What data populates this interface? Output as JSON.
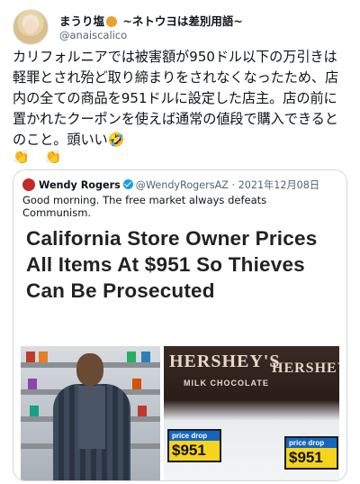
{
  "author": {
    "display_name": "まうり塩🍊 ~ネトウヨは差別用語~",
    "display_name_prefix": "まうり塩",
    "display_name_suffix": " ~ネトウヨは差別用語~",
    "handle": "@anaiscalico"
  },
  "tweet": {
    "text": "カリフォルニアでは被害額が950ドル以下の万引きは軽罪とされ殆ど取り締まりをされなくなったため、店内の全ての商品を951ドルに設定した店主。店の前に置かれたクーポンを使えば通常の値段で購入できるとのこと。頭いい🤣",
    "emojis": "👏 👏"
  },
  "quoted": {
    "name": "Wendy Rogers",
    "handle": "@WendyRogersAZ",
    "date": "2021年12月08日",
    "separator": "·",
    "text": "Good morning. The free market always defeats Communism.",
    "headline": "California Store Owner Prices All Items At $951 So Thieves Can Be Prosecuted",
    "photo": {
      "candy_label_1": "HERSHEY'S",
      "candy_label_2": "MILK CHOCOLATE",
      "tag_band": "price drop",
      "tag_price": "$951"
    }
  }
}
